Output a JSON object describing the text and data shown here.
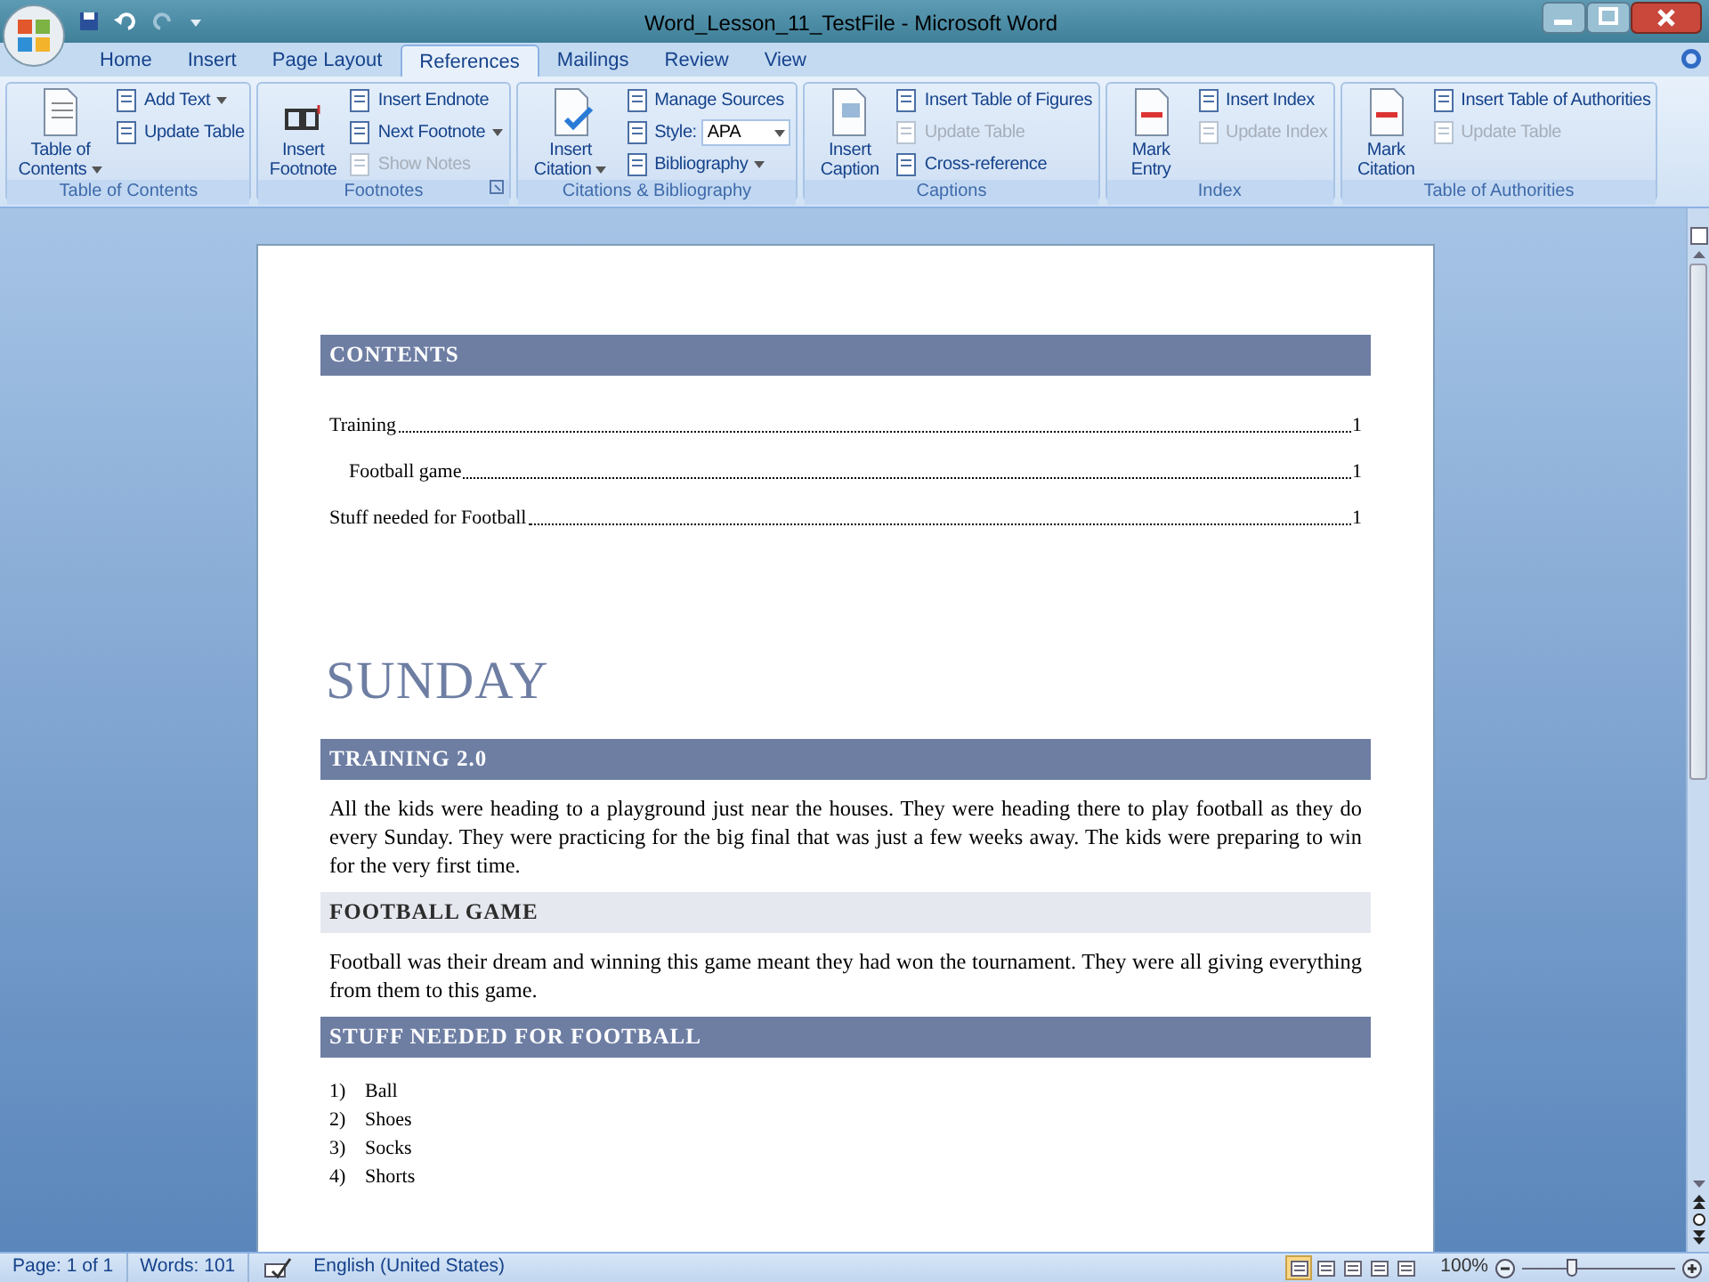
{
  "window": {
    "title": "Word_Lesson_11_TestFile - Microsoft Word"
  },
  "tabs": [
    {
      "label": "Home",
      "selected": false
    },
    {
      "label": "Insert",
      "selected": false
    },
    {
      "label": "Page Layout",
      "selected": false
    },
    {
      "label": "References",
      "selected": true
    },
    {
      "label": "Mailings",
      "selected": false
    },
    {
      "label": "Review",
      "selected": false
    },
    {
      "label": "View",
      "selected": false
    }
  ],
  "ribbon_groups": [
    {
      "name": "Table of Contents",
      "launcher": false,
      "items": [
        {
          "kind": "large",
          "label": "Table of Contents",
          "dropdown": true
        },
        {
          "kind": "small",
          "label": "Add Text",
          "dropdown": true,
          "disabled": false
        },
        {
          "kind": "small",
          "label": "Update Table",
          "dropdown": false,
          "disabled": false
        }
      ]
    },
    {
      "name": "Footnotes",
      "launcher": true,
      "items": [
        {
          "kind": "large",
          "label": "Insert Footnote",
          "dropdown": false
        },
        {
          "kind": "small",
          "label": "Insert Endnote",
          "dropdown": false,
          "disabled": false
        },
        {
          "kind": "small",
          "label": "Next Footnote",
          "dropdown": true,
          "disabled": false
        },
        {
          "kind": "small",
          "label": "Show Notes",
          "dropdown": false,
          "disabled": true
        }
      ]
    },
    {
      "name": "Citations & Bibliography",
      "launcher": false,
      "items": [
        {
          "kind": "large",
          "label": "Insert Citation",
          "dropdown": true
        },
        {
          "kind": "small",
          "label": "Manage Sources",
          "dropdown": false,
          "disabled": false
        },
        {
          "kind": "combo",
          "label": "Style:",
          "value": "APA"
        },
        {
          "kind": "small",
          "label": "Bibliography",
          "dropdown": true,
          "disabled": false
        }
      ]
    },
    {
      "name": "Captions",
      "launcher": false,
      "items": [
        {
          "kind": "large",
          "label": "Insert Caption",
          "dropdown": false
        },
        {
          "kind": "small",
          "label": "Insert Table of Figures",
          "dropdown": false,
          "disabled": false
        },
        {
          "kind": "small",
          "label": "Update Table",
          "dropdown": false,
          "disabled": true
        },
        {
          "kind": "small",
          "label": "Cross-reference",
          "dropdown": false,
          "disabled": false
        }
      ]
    },
    {
      "name": "Index",
      "launcher": false,
      "items": [
        {
          "kind": "large",
          "label": "Mark Entry",
          "dropdown": false
        },
        {
          "kind": "small",
          "label": "Insert Index",
          "dropdown": false,
          "disabled": false
        },
        {
          "kind": "small",
          "label": "Update Index",
          "dropdown": false,
          "disabled": true
        }
      ]
    },
    {
      "name": "Table of Authorities",
      "launcher": false,
      "items": [
        {
          "kind": "large",
          "label": "Mark Citation",
          "dropdown": false
        },
        {
          "kind": "small",
          "label": "Insert Table of Authorities",
          "dropdown": false,
          "disabled": false
        },
        {
          "kind": "small",
          "label": "Update Table",
          "dropdown": false,
          "disabled": true
        }
      ]
    }
  ],
  "document": {
    "toc": {
      "heading": "CONTENTS",
      "entries": [
        {
          "text": "Training",
          "page": "1",
          "children": [
            {
              "text": "Football game",
              "page": "1"
            }
          ]
        },
        {
          "text": "Stuff needed for Football",
          "page": "1"
        }
      ]
    },
    "title": "SUNDAY",
    "sections": [
      {
        "heading": "TRAINING 2.0",
        "kind": "paragraph",
        "text": "All the kids were heading to a playground just near the houses. They were heading there to play football as they do every Sunday. They were practicing for the big final that was just a few weeks away.  The kids were preparing to win for the very first time."
      },
      {
        "heading": "FOOTBALL GAME",
        "kind": "paragraph",
        "text": "Football was their dream and winning this game meant they had won the tournament. They were all giving everything from them to this game."
      },
      {
        "heading": "STUFF NEEDED FOR FOOTBALL",
        "kind": "list",
        "items": [
          {
            "number": "1)",
            "text": "Ball"
          },
          {
            "number": "2)",
            "text": "Shoes"
          },
          {
            "number": "3)",
            "text": "Socks"
          },
          {
            "number": "4)",
            "text": "Shorts"
          }
        ]
      }
    ]
  },
  "status_bar": {
    "page": "Page: 1 of 1",
    "words": "Words: 101",
    "language": "English (United States)",
    "views": [
      {
        "selected": true
      },
      {
        "selected": false
      },
      {
        "selected": false
      },
      {
        "selected": false
      },
      {
        "selected": false
      }
    ],
    "zoom": "100%",
    "zoom_slider": {
      "level": 0.32
    }
  }
}
